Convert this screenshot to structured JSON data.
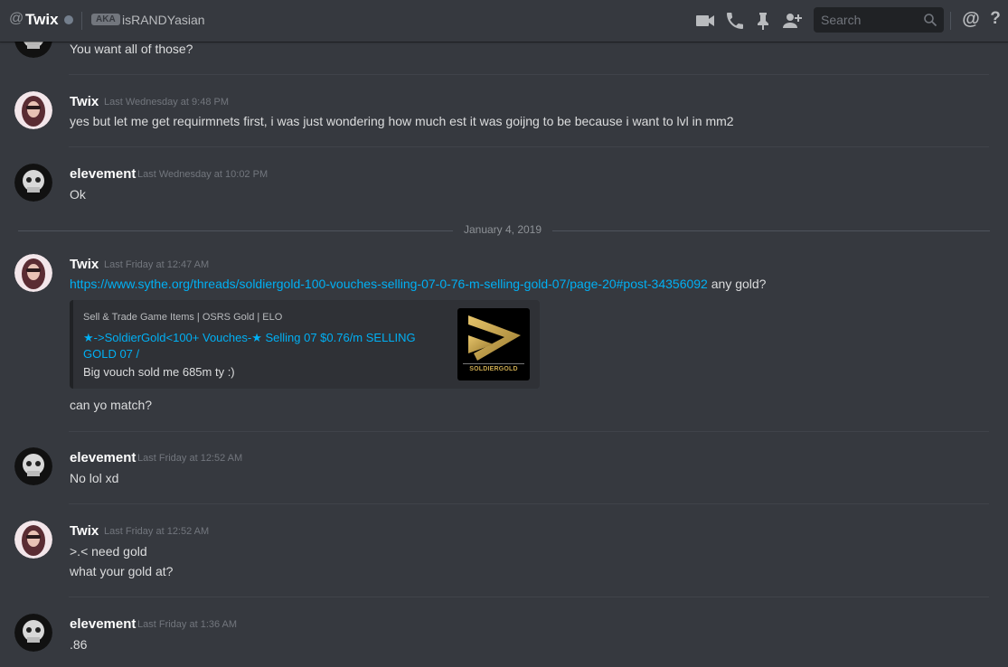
{
  "header": {
    "at_symbol": "@",
    "username": "Twix",
    "aka_badge": "AKA",
    "alias": "isRANDYasian",
    "search_placeholder": "Search",
    "icons": [
      "video-call-icon",
      "voice-call-icon",
      "pin-icon",
      "add-friend-icon",
      "search-icon",
      "mention-icon",
      "help-icon"
    ],
    "mention_symbol": "@",
    "help_symbol": "?"
  },
  "date_divider": "January 4, 2019",
  "messages": [
    {
      "author": "",
      "timestamp": "",
      "lines": [
        "You want all of those?"
      ]
    },
    {
      "author": "Twix",
      "timestamp": "Last Wednesday at 9:48 PM",
      "lines": [
        "yes but let me get requirmnets first, i was just wondering how much est it was goijng to be because i want to  lvl in mm2"
      ]
    },
    {
      "author": "elevement",
      "timestamp": "Last Wednesday at 10:02 PM",
      "lines": [
        "Ok"
      ]
    },
    {
      "author": "Twix",
      "timestamp": "Last Friday at 12:47 AM",
      "link": "https://www.sythe.org/threads/soldiergold-100-vouches-selling-07-0-76-m-selling-gold-07/page-20#post-34356092",
      "link_suffix": " any gold?",
      "after_embed": "can yo match?",
      "embed": {
        "provider": "Sell & Trade Game Items | OSRS Gold | ELO",
        "title": "★->SoldierGold<100+ Vouches-★ Selling 07 $0.76/m SELLING GOLD 07 /",
        "description": "Big vouch sold me 685m ty :)",
        "thumbnail_text": "SOLDIERGOLD"
      }
    },
    {
      "author": "elevement",
      "timestamp": "Last Friday at 12:52 AM",
      "lines": [
        "No lol xd"
      ]
    },
    {
      "author": "Twix",
      "timestamp": "Last Friday at 12:52 AM",
      "lines": [
        ">.< need gold",
        "what your gold at?"
      ]
    },
    {
      "author": "elevement",
      "timestamp": "Last Friday at 1:36 AM",
      "lines": [
        ".86"
      ]
    }
  ],
  "colors": {
    "background": "#36393f",
    "link": "#00b0f4",
    "timestamp": "#72767d",
    "username": "#ffffff",
    "embed_bg": "#2f3136"
  }
}
